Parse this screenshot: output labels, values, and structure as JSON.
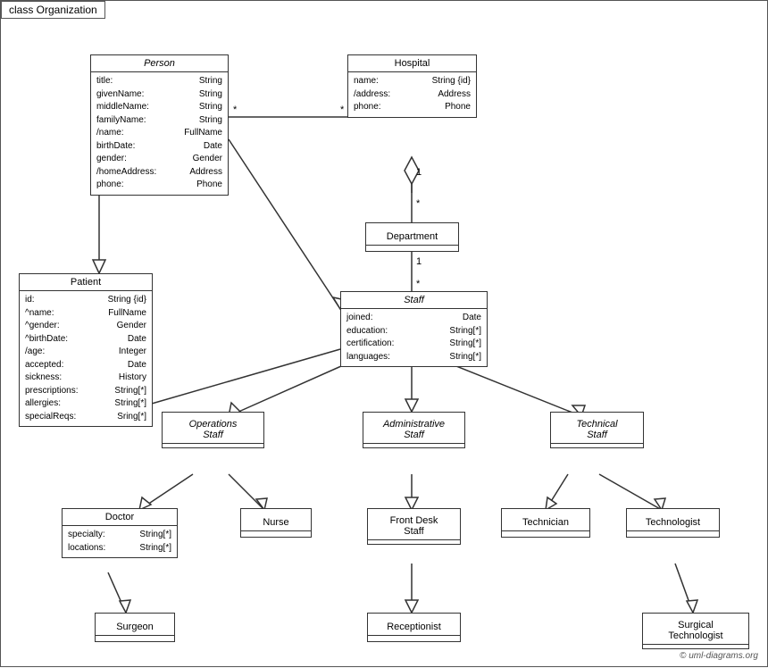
{
  "diagram": {
    "frame_label": "class Organization",
    "copyright": "© uml-diagrams.org",
    "boxes": {
      "person": {
        "title": "Person",
        "italic": true,
        "attrs": [
          {
            "name": "title:",
            "type": "String"
          },
          {
            "name": "givenName:",
            "type": "String"
          },
          {
            "name": "middleName:",
            "type": "String"
          },
          {
            "name": "familyName:",
            "type": "String"
          },
          {
            "name": "/name:",
            "type": "FullName"
          },
          {
            "name": "birthDate:",
            "type": "Date"
          },
          {
            "name": "gender:",
            "type": "Gender"
          },
          {
            "name": "/homeAddress:",
            "type": "Address"
          },
          {
            "name": "phone:",
            "type": "Phone"
          }
        ]
      },
      "hospital": {
        "title": "Hospital",
        "italic": false,
        "attrs": [
          {
            "name": "name:",
            "type": "String {id}"
          },
          {
            "name": "/address:",
            "type": "Address"
          },
          {
            "name": "phone:",
            "type": "Phone"
          }
        ]
      },
      "department": {
        "title": "Department",
        "italic": false,
        "attrs": []
      },
      "patient": {
        "title": "Patient",
        "italic": false,
        "attrs": [
          {
            "name": "id:",
            "type": "String {id}"
          },
          {
            "name": "^name:",
            "type": "FullName"
          },
          {
            "name": "^gender:",
            "type": "Gender"
          },
          {
            "name": "^birthDate:",
            "type": "Date"
          },
          {
            "name": "/age:",
            "type": "Integer"
          },
          {
            "name": "accepted:",
            "type": "Date"
          },
          {
            "name": "sickness:",
            "type": "History"
          },
          {
            "name": "prescriptions:",
            "type": "String[*]"
          },
          {
            "name": "allergies:",
            "type": "String[*]"
          },
          {
            "name": "specialReqs:",
            "type": "Sring[*]"
          }
        ]
      },
      "staff": {
        "title": "Staff",
        "italic": true,
        "attrs": [
          {
            "name": "joined:",
            "type": "Date"
          },
          {
            "name": "education:",
            "type": "String[*]"
          },
          {
            "name": "certification:",
            "type": "String[*]"
          },
          {
            "name": "languages:",
            "type": "String[*]"
          }
        ]
      },
      "operations_staff": {
        "title": "Operations Staff",
        "italic": true,
        "attrs": []
      },
      "administrative_staff": {
        "title": "Administrative Staff",
        "italic": true,
        "attrs": []
      },
      "technical_staff": {
        "title": "Technical Staff",
        "italic": true,
        "attrs": []
      },
      "doctor": {
        "title": "Doctor",
        "italic": false,
        "attrs": [
          {
            "name": "specialty:",
            "type": "String[*]"
          },
          {
            "name": "locations:",
            "type": "String[*]"
          }
        ]
      },
      "nurse": {
        "title": "Nurse",
        "italic": false,
        "attrs": []
      },
      "front_desk_staff": {
        "title": "Front Desk Staff",
        "italic": false,
        "attrs": []
      },
      "technician": {
        "title": "Technician",
        "italic": false,
        "attrs": []
      },
      "technologist": {
        "title": "Technologist",
        "italic": false,
        "attrs": []
      },
      "surgeon": {
        "title": "Surgeon",
        "italic": false,
        "attrs": []
      },
      "receptionist": {
        "title": "Receptionist",
        "italic": false,
        "attrs": []
      },
      "surgical_technologist": {
        "title": "Surgical Technologist",
        "italic": false,
        "attrs": []
      }
    }
  }
}
